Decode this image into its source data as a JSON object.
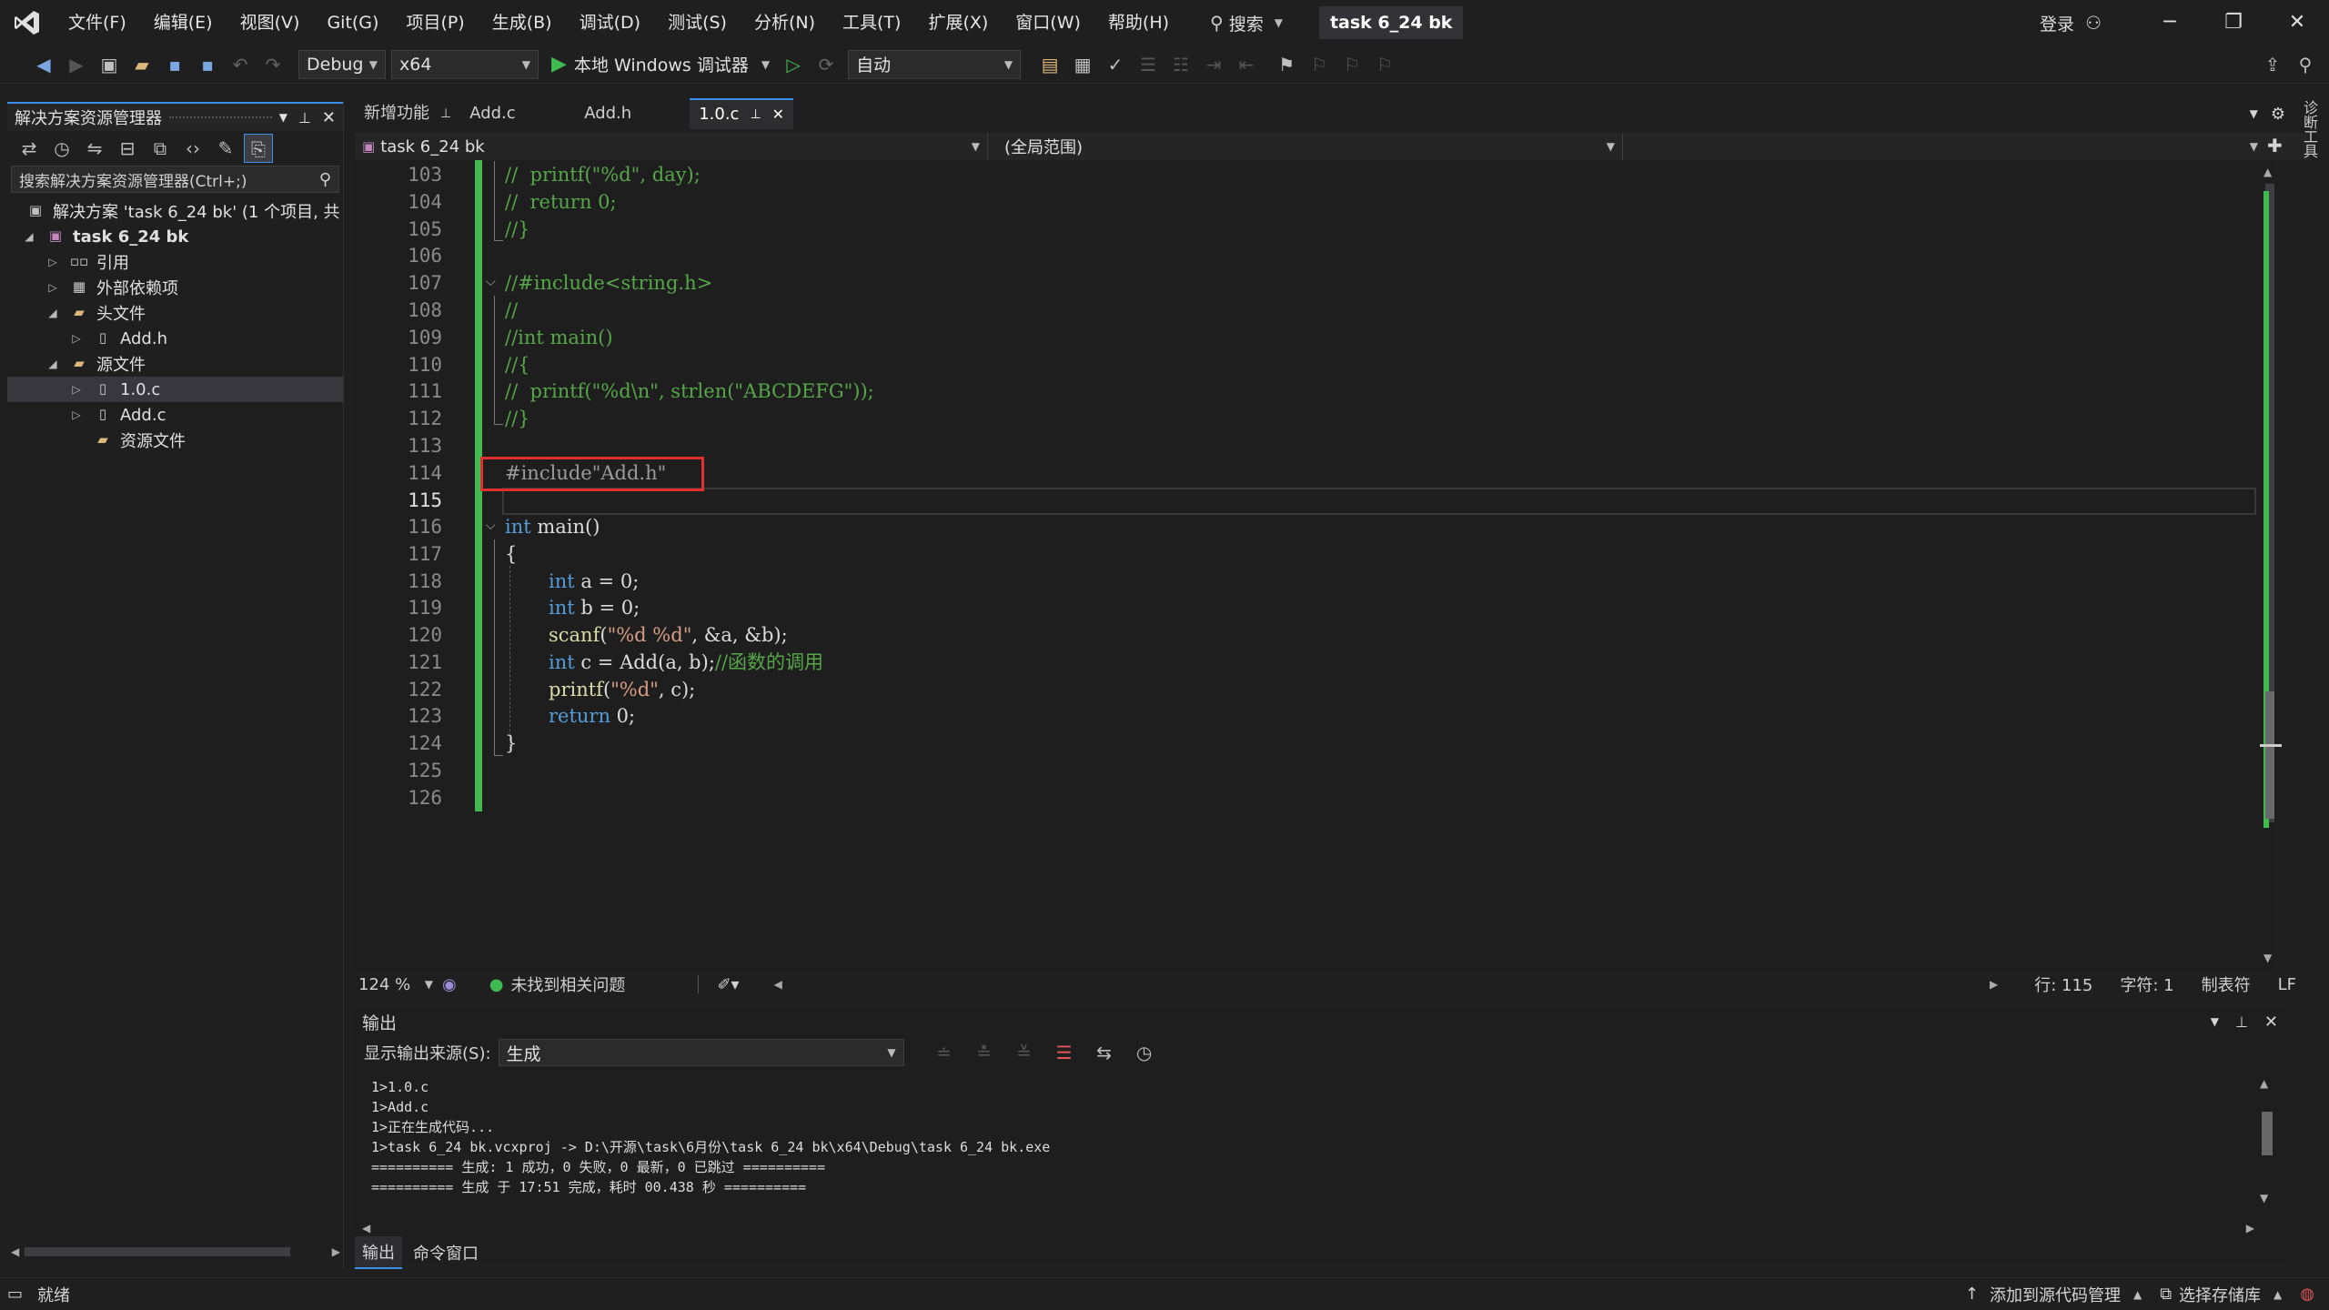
{
  "app": {
    "title": "task 6_24 bk",
    "search_label": "搜索",
    "login_label": "登录"
  },
  "menu": [
    "文件(F)",
    "编辑(E)",
    "视图(V)",
    "Git(G)",
    "项目(P)",
    "生成(B)",
    "调试(D)",
    "测试(S)",
    "分析(N)",
    "工具(T)",
    "扩展(X)",
    "窗口(W)",
    "帮助(H)"
  ],
  "toolbar": {
    "config": "Debug",
    "platform": "x64",
    "run_label": "本地 Windows 调试器",
    "mode": "自动"
  },
  "solution_explorer": {
    "title": "解决方案资源管理器",
    "search_placeholder": "搜索解决方案资源管理器(Ctrl+;)",
    "items": [
      {
        "label": "解决方案 'task 6_24 bk' (1 个项目, 共"
      },
      {
        "label": "task 6_24 bk"
      },
      {
        "label": "引用"
      },
      {
        "label": "外部依赖项"
      },
      {
        "label": "头文件"
      },
      {
        "label": "Add.h"
      },
      {
        "label": "源文件"
      },
      {
        "label": "1.0.c"
      },
      {
        "label": "Add.c"
      },
      {
        "label": "资源文件"
      }
    ]
  },
  "tabs": [
    {
      "label": "新增功能"
    },
    {
      "label": "Add.c"
    },
    {
      "label": "Add.h"
    },
    {
      "label": "1.0.c"
    }
  ],
  "navbar": {
    "project": "task 6_24 bk",
    "scope": "(全局范围)"
  },
  "code": {
    "line_numbers": [
      "103",
      "104",
      "105",
      "106",
      "107",
      "108",
      "109",
      "110",
      "111",
      "112",
      "113",
      "114",
      "115",
      "116",
      "117",
      "118",
      "119",
      "120",
      "121",
      "122",
      "123",
      "124",
      "125",
      "126"
    ],
    "l103": "//  printf(\"%d\", day);",
    "l104": "//  return 0;",
    "l105": "//}",
    "l107": "//#include<string.h>",
    "l108": "//",
    "l109": "//int main()",
    "l110": "//{",
    "l111": "//  printf(\"%d\\n\", strlen(\"ABCDEFG\"));",
    "l112": "//}",
    "l114": "#include\"Add.h\"",
    "l116_kw": "int",
    "l116_rest": " main()",
    "l117": "{",
    "l118_kw": "int",
    "l118_rest": " a = 0;",
    "l119_kw": "int",
    "l119_rest": " b = 0;",
    "l120_fn": "scanf",
    "l120_str": "\"%d %d\"",
    "l120_rest": ", &a, &b);",
    "l121_kw": "int",
    "l121_rest": " c = Add(a, b);",
    "l121_cm": "//函数的调用",
    "l122_fn": "printf",
    "l122_str": "\"%d\"",
    "l122_rest": ", c);",
    "l123_kw": "return",
    "l123_rest": " 0;",
    "l124": "}"
  },
  "editor_status": {
    "zoom": "124 %",
    "issues": "未找到相关问题",
    "line": "行: 115",
    "char": "字符: 1",
    "tabs": "制表符",
    "eol": "LF"
  },
  "output": {
    "title": "输出",
    "source_label": "显示输出来源(S):",
    "source_value": "生成",
    "lines": [
      "1>1.0.c",
      "1>Add.c",
      "1>正在生成代码...",
      "1>task 6_24 bk.vcxproj -> D:\\开源\\task\\6月份\\task 6_24 bk\\x64\\Debug\\task 6_24 bk.exe",
      "========== 生成: 1 成功，0 失败，0 最新，0 已跳过 ==========",
      "========== 生成 于 17:51 完成，耗时 00.438 秒 =========="
    ],
    "tabs": [
      "输出",
      "命令窗口"
    ]
  },
  "statusbar": {
    "ready": "就绪",
    "source_control": "添加到源代码管理",
    "repo": "选择存储库"
  },
  "side_tab": "诊断工具"
}
